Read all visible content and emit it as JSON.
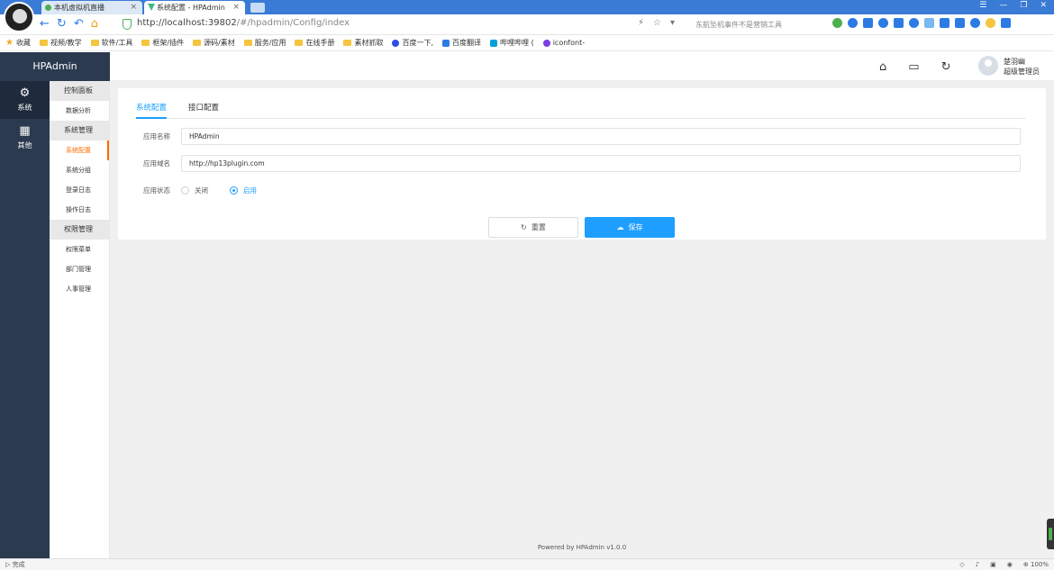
{
  "browser": {
    "tabs": [
      {
        "title": "本机虚拟机直播",
        "close": "×"
      },
      {
        "title": "系统配置 - HPAdmin",
        "close": "×"
      }
    ],
    "url_host": "http://localhost:39802",
    "url_path": "/#/hpadmin/Config/index",
    "search_placeholder": "东航坠机事件不是营销工具",
    "status_left": "完成",
    "zoom": "100%",
    "bookmarks": [
      "收藏",
      "视频/教学",
      "软件/工具",
      "框架/插件",
      "源码/素材",
      "服务/应用",
      "在线手册",
      "素材抓取",
      "百度一下,",
      "百度翻译",
      "哔哩哔哩 (",
      "iconfont-"
    ]
  },
  "app": {
    "logo": "HPAdmin",
    "user": {
      "name": "楚羽幽",
      "role": "超级管理员"
    },
    "sidebar": [
      {
        "label": "系统",
        "icon": "gear-icon"
      },
      {
        "label": "其他",
        "icon": "calendar-icon"
      }
    ],
    "submenu": {
      "group1": "控制面板",
      "item_dashboard": "数据分析",
      "group2": "系统管理",
      "items_system": [
        "系统配置",
        "系统分组",
        "登录日志",
        "操作日志"
      ],
      "group3": "权限管理",
      "items_auth": [
        "权限菜单",
        "部门管理",
        "人事管理"
      ]
    },
    "tabs": [
      "系统配置",
      "接口配置"
    ],
    "form": {
      "app_name_label": "应用名称",
      "app_name_value": "HPAdmin",
      "app_domain_label": "应用域名",
      "app_domain_value": "http://hp13plugin.com",
      "app_status_label": "应用状态",
      "status_off": "关闭",
      "status_on": "启用"
    },
    "buttons": {
      "reset": "重置",
      "save": "保存"
    },
    "footer": "Powered by HPAdmin v1.0.0"
  },
  "colors": {
    "accent": "#1e9fff",
    "sidebar": "#2b3a4f",
    "active_menu": "#ff6a00"
  }
}
